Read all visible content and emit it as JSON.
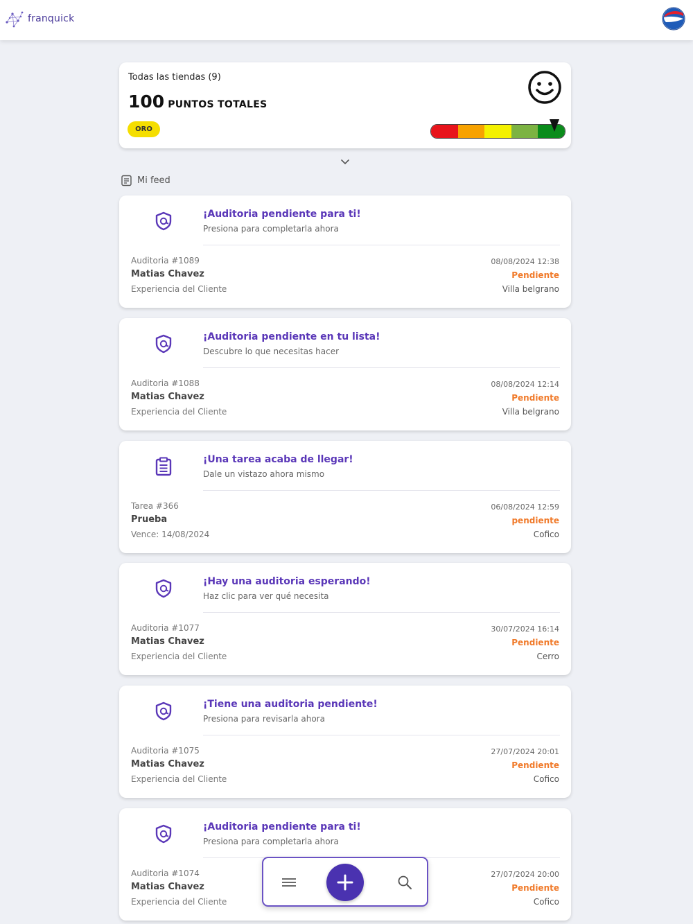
{
  "app": {
    "name": "franquick",
    "logo_icon": "network-logo-icon",
    "brand_icon": "pepsi-logo-icon"
  },
  "summary": {
    "stores_label": "Todas las tiendas (9)",
    "points_value": "100",
    "points_label": "Puntos totales",
    "level_badge": "ORO",
    "mood_icon": "smiley-face-icon",
    "meter_colors": [
      "#e8141b",
      "#f7a200",
      "#f4f100",
      "#7cb342",
      "#0a8c1b"
    ],
    "meter_level": 0.92
  },
  "feed_header": {
    "label": "Mi feed",
    "icon": "document-icon"
  },
  "feed": [
    {
      "icon": "shield-audit-icon",
      "title": "¡Auditoria pendiente para ti!",
      "subtitle": "Presiona para completarla ahora",
      "ref": "Auditoria #1089",
      "person": "Matias Chavez",
      "category": "Experiencia del Cliente",
      "datetime": "08/08/2024 12:38",
      "status": "Pendiente",
      "store": "Villa belgrano"
    },
    {
      "icon": "shield-audit-icon",
      "title": "¡Auditoria pendiente en tu lista!",
      "subtitle": "Descubre lo que necesitas hacer",
      "ref": "Auditoria #1088",
      "person": "Matias Chavez",
      "category": "Experiencia del Cliente",
      "datetime": "08/08/2024 12:14",
      "status": "Pendiente",
      "store": "Villa belgrano"
    },
    {
      "icon": "clipboard-task-icon",
      "title": "¡Una tarea acaba de llegar!",
      "subtitle": "Dale un vistazo ahora mismo",
      "ref": "Tarea #366",
      "person": "Prueba",
      "category": "Vence: 14/08/2024",
      "datetime": "06/08/2024 12:59",
      "status": "pendiente",
      "store": "Cofico"
    },
    {
      "icon": "shield-audit-icon",
      "title": "¡Hay una auditoria esperando!",
      "subtitle": "Haz clic para ver qué necesita",
      "ref": "Auditoria #1077",
      "person": "Matias Chavez",
      "category": "Experiencia del Cliente",
      "datetime": "30/07/2024 16:14",
      "status": "Pendiente",
      "store": "Cerro"
    },
    {
      "icon": "shield-audit-icon",
      "title": "¡Tiene una auditoria pendiente!",
      "subtitle": "Presiona para revisarla ahora",
      "ref": "Auditoria #1075",
      "person": "Matias Chavez",
      "category": "Experiencia del Cliente",
      "datetime": "27/07/2024 20:01",
      "status": "Pendiente",
      "store": "Cofico"
    },
    {
      "icon": "shield-audit-icon",
      "title": "¡Auditoria pendiente para ti!",
      "subtitle": "Presiona para completarla ahora",
      "ref": "Auditoria #1074",
      "person": "Matias Chavez",
      "category": "Experiencia del Cliente",
      "datetime": "27/07/2024 20:00",
      "status": "Pendiente",
      "store": "Cofico"
    }
  ],
  "bottom_nav": {
    "menu_icon": "hamburger-menu-icon",
    "add_icon": "plus-icon",
    "search_icon": "search-icon"
  },
  "colors": {
    "accent": "#5a37b8",
    "status": "#f07a2a",
    "badge": "#f5de00",
    "fab": "#4a32b0"
  }
}
